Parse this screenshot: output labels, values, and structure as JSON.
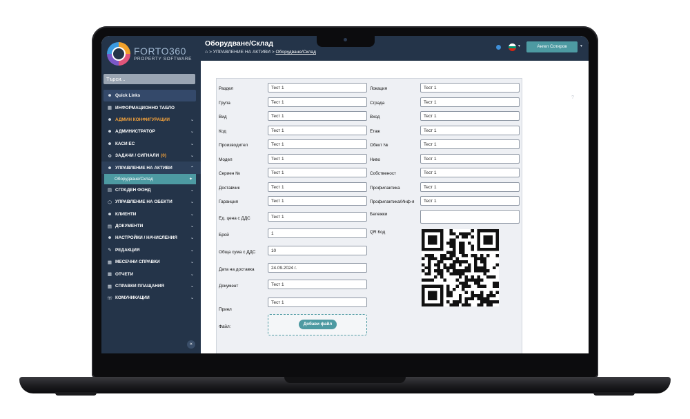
{
  "brand": {
    "name_a": "FORTO",
    "name_b": "360",
    "tagline": "PROPERTY SOFTWARE"
  },
  "search": {
    "placeholder": "Търси..."
  },
  "sidebar": {
    "items": [
      {
        "label": "Quick Links",
        "icon": "user-icon"
      },
      {
        "label": "ИНФОРМАЦИОННО ТАБЛО",
        "icon": "dashboard-icon"
      },
      {
        "label": "АДМИН КОНФИГУРАЦИИ",
        "icon": "user-icon"
      },
      {
        "label": "АДМИНИСТРАТОР",
        "icon": "user-icon"
      },
      {
        "label": "КАСИ ЕС",
        "icon": "user-icon"
      },
      {
        "label": "ЗАДАЧИ / СИГНАЛИ",
        "badge": "(0)",
        "icon": "tasks-icon"
      },
      {
        "label": "УПРАВЛЕНИЕ НА АКТИВИ",
        "icon": "user-icon"
      },
      {
        "label": "СГРАДЕН ФОНД",
        "icon": "building-icon"
      },
      {
        "label": "УПРАВЛЕНИЕ НА ОБЕКТИ",
        "icon": "cube-icon"
      },
      {
        "label": "КЛИЕНТИ",
        "icon": "user-icon"
      },
      {
        "label": "ДОКУМЕНТИ",
        "icon": "document-icon"
      },
      {
        "label": "НАСТРОЙКИ / НАЧИСЛЕНИЯ",
        "icon": "user-icon"
      },
      {
        "label": "РЕДАКЦИЯ",
        "icon": "edit-icon"
      },
      {
        "label": "МЕСЕЧНИ СПРАВКИ",
        "icon": "report-icon"
      },
      {
        "label": "ОТЧЕТИ",
        "icon": "report-icon"
      },
      {
        "label": "СПРАВКИ ПЛАЩАНИЯ",
        "icon": "report-icon"
      },
      {
        "label": "КОМУНИКАЦИИ",
        "icon": "headset-icon"
      }
    ],
    "active_sub": "Оборудване/Склад"
  },
  "header": {
    "title": "Оборудване/Склад",
    "crumb_1": "УПРАВЛЕНИЕ НА АКТИВИ",
    "crumb_sep": ">",
    "crumb_2": "Оборудване/Склад",
    "user": "Ангел Сотиров"
  },
  "form": {
    "left": [
      {
        "label": "Раздел",
        "value": "Тест 1"
      },
      {
        "label": "Група",
        "value": "Тест 1"
      },
      {
        "label": "Вид",
        "value": "Тест 1"
      },
      {
        "label": "Код",
        "value": "Тест 1"
      },
      {
        "label": "Производител",
        "value": "Тест 1"
      },
      {
        "label": "Модел",
        "value": "Тест 1"
      },
      {
        "label": "Сериен №",
        "value": "Тест 1"
      },
      {
        "label": "Доставчик",
        "value": "Тест 1"
      },
      {
        "label": "Гаранция",
        "value": "Тест 1"
      },
      {
        "label": "Ед. цена с ДДС",
        "value": "Тест 1"
      },
      {
        "label": "Брой",
        "value": "1"
      },
      {
        "label": "Обща сума с ДДС",
        "value": "10"
      },
      {
        "label": "Дата на доставка",
        "value": "24.09.2024 г."
      },
      {
        "label": "Документ",
        "value": "Тест 1"
      },
      {
        "label": "Приел",
        "value": "Тест 1"
      }
    ],
    "right": [
      {
        "label": "Локация",
        "value": "Тест 1"
      },
      {
        "label": "Сграда",
        "value": "Тест 1"
      },
      {
        "label": "Вход",
        "value": "Тест 1"
      },
      {
        "label": "Етаж",
        "value": "Тест 1"
      },
      {
        "label": "Обект №",
        "value": "Тест 1"
      },
      {
        "label": "Ниво",
        "value": "Тест 1"
      },
      {
        "label": "Собственост",
        "value": "Тест 1"
      },
      {
        "label": "Профилактика",
        "value": "Тест 1"
      },
      {
        "label": "Профилактика/Инф-я",
        "value": "Тест 1"
      }
    ],
    "notes_label": "Бележки",
    "notes_value": "",
    "qr_label": "QR Код",
    "file_label": "Файл:",
    "upload_label": "Добави файл"
  },
  "colors": {
    "sidebar": "#243449",
    "accent": "#4d9aa2",
    "orange": "#f4a23a"
  }
}
